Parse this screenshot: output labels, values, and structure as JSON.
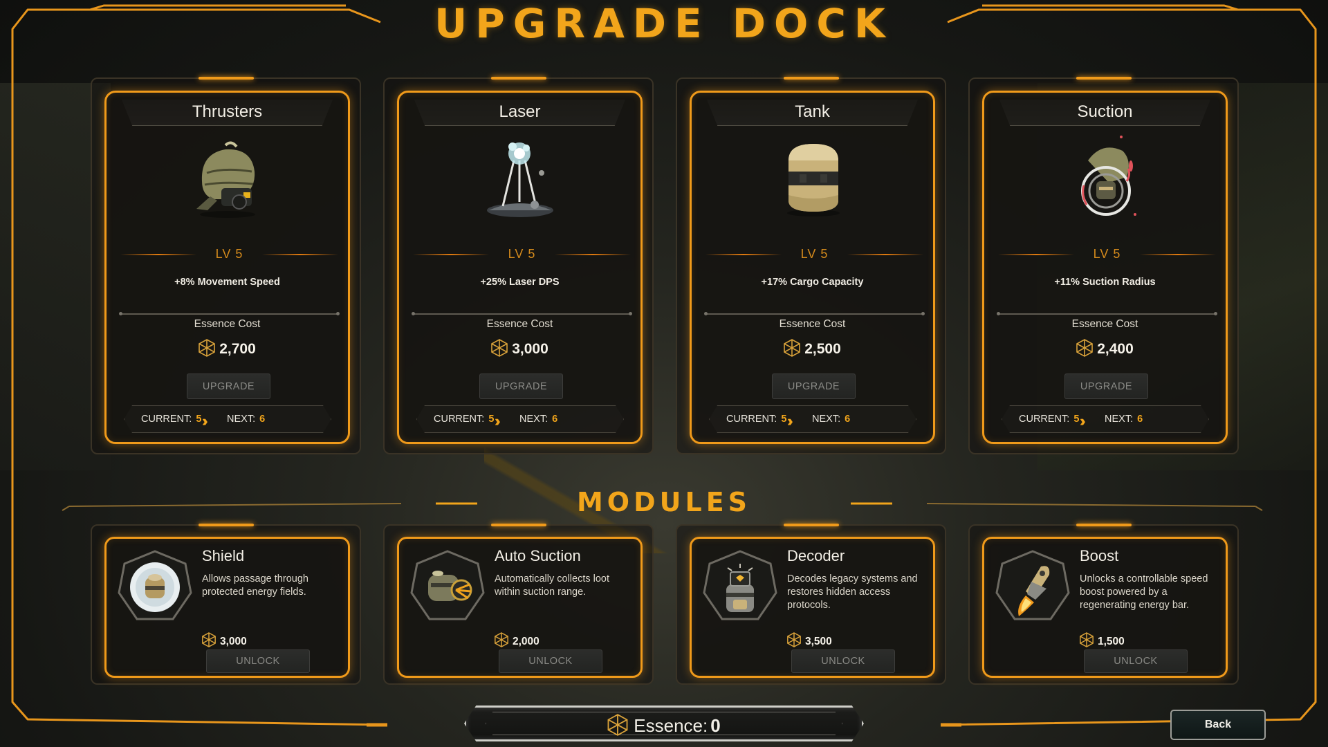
{
  "title": "UPGRADE DOCK",
  "upgrades": [
    {
      "name": "Thrusters",
      "level": "LV 5",
      "description": "+8% Movement Speed",
      "cost_label": "Essence Cost",
      "cost": "2,700",
      "button": "UPGRADE",
      "current_label": "CURRENT:",
      "current": "5",
      "next_label": "NEXT:",
      "next": "6",
      "art": "thruster-pod"
    },
    {
      "name": "Laser",
      "level": "LV 5",
      "description": "+25% Laser DPS",
      "cost_label": "Essence Cost",
      "cost": "3,000",
      "button": "UPGRADE",
      "current_label": "CURRENT:",
      "current": "5",
      "next_label": "NEXT:",
      "next": "6",
      "art": "laser-tripod"
    },
    {
      "name": "Tank",
      "level": "LV 5",
      "description": "+17% Cargo Capacity",
      "cost_label": "Essence Cost",
      "cost": "2,500",
      "button": "UPGRADE",
      "current_label": "CURRENT:",
      "current": "5",
      "next_label": "NEXT:",
      "next": "6",
      "art": "cargo-tank"
    },
    {
      "name": "Suction",
      "level": "LV 5",
      "description": "+11% Suction Radius",
      "cost_label": "Essence Cost",
      "cost": "2,400",
      "button": "UPGRADE",
      "current_label": "CURRENT:",
      "current": "5",
      "next_label": "NEXT:",
      "next": "6",
      "art": "suction-ring"
    }
  ],
  "modules_title": "MODULES",
  "modules": [
    {
      "name": "Shield",
      "description": "Allows passage through protected energy fields.",
      "cost": "3,000",
      "button": "UNLOCK",
      "icon": "shield-orb"
    },
    {
      "name": "Auto Suction",
      "description": "Automatically collects loot within suction range.",
      "cost": "2,000",
      "button": "UNLOCK",
      "icon": "auto-suction-drone"
    },
    {
      "name": "Decoder",
      "description": "Decodes legacy systems and restores hidden access protocols.",
      "cost": "3,500",
      "button": "UNLOCK",
      "icon": "decoder-device"
    },
    {
      "name": "Boost",
      "description": "Unlocks a controllable speed boost powered by a regenerating energy bar.",
      "cost": "1,500",
      "button": "UNLOCK",
      "icon": "boost-rocket"
    }
  ],
  "essence": {
    "label": "Essence:",
    "value": "0"
  },
  "back_button": "Back",
  "colors": {
    "accent": "#f2a51b",
    "frame": "#f09a1a",
    "button_disabled_text": "#8a8a86"
  }
}
